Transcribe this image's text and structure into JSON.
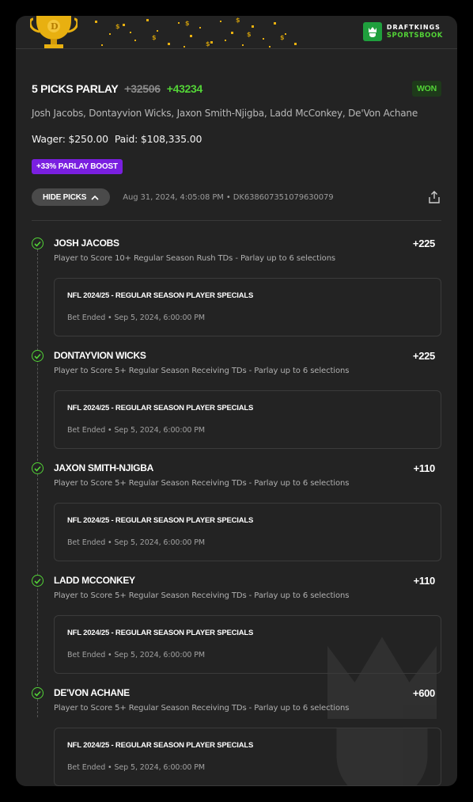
{
  "brand": {
    "line1": "DRAFTKINGS",
    "line2": "SPORTSBOOK",
    "accent": "#53d337",
    "logo_bg": "#1f9f3d"
  },
  "bet": {
    "title": "5 PICKS PARLAY",
    "odds_original": "+32506",
    "odds_boosted": "+43234",
    "status": "WON",
    "players": "Josh Jacobs, Dontayvion Wicks, Jaxon Smith-Njigba, Ladd McConkey, De'Von Achane",
    "wager": "Wager: $250.00",
    "paid": "Paid: $108,335.00",
    "boost_label": "+33% PARLAY BOOST",
    "boost_color": "#7a1fe0",
    "hide_picks_label": "HIDE PICKS",
    "meta": "Aug 31, 2024, 4:05:08 PM • DK638607351079630079"
  },
  "picks": [
    {
      "name": "JOSH JACOBS",
      "odds": "+225",
      "description": "Player to Score 10+ Regular Season Rush TDs - Parlay up to 6 selections",
      "event": "NFL 2024/25 - REGULAR SEASON PLAYER SPECIALS",
      "event_status": "Bet Ended • Sep 5, 2024, 6:00:00 PM"
    },
    {
      "name": "DONTAYVION WICKS",
      "odds": "+225",
      "description": "Player to Score 5+ Regular Season Receiving TDs - Parlay up to 6 selections",
      "event": "NFL 2024/25 - REGULAR SEASON PLAYER SPECIALS",
      "event_status": "Bet Ended • Sep 5, 2024, 6:00:00 PM"
    },
    {
      "name": "JAXON SMITH-NJIGBA",
      "odds": "+110",
      "description": "Player to Score 5+ Regular Season Receiving TDs - Parlay up to 6 selections",
      "event": "NFL 2024/25 - REGULAR SEASON PLAYER SPECIALS",
      "event_status": "Bet Ended • Sep 5, 2024, 6:00:00 PM"
    },
    {
      "name": "LADD MCCONKEY",
      "odds": "+110",
      "description": "Player to Score 5+ Regular Season Receiving TDs - Parlay up to 6 selections",
      "event": "NFL 2024/25 - REGULAR SEASON PLAYER SPECIALS",
      "event_status": "Bet Ended • Sep 5, 2024, 6:00:00 PM"
    },
    {
      "name": "DE'VON ACHANE",
      "odds": "+600",
      "description": "Player to Score 5+ Regular Season Receiving TDs - Parlay up to 6 selections",
      "event": "NFL 2024/25 - REGULAR SEASON PLAYER SPECIALS",
      "event_status": "Bet Ended • Sep 5, 2024, 6:00:00 PM"
    }
  ]
}
